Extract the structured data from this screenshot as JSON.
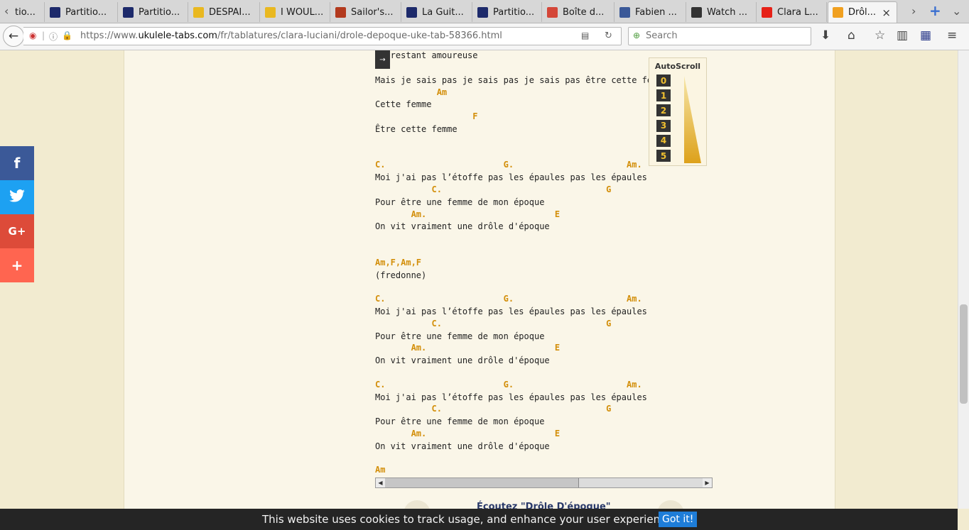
{
  "browser": {
    "tabs": [
      {
        "label": "tio...",
        "icon": "page",
        "color": ""
      },
      {
        "label": "Partitio...",
        "icon": "b-logo",
        "color": "#1d2a6b"
      },
      {
        "label": "Partitio...",
        "icon": "b-logo",
        "color": "#1d2a6b"
      },
      {
        "label": "DESPAI...",
        "icon": "shield-logo",
        "color": "#e9b820"
      },
      {
        "label": "I WOUL...",
        "icon": "shield-logo",
        "color": "#e9b820"
      },
      {
        "label": "Sailor's...",
        "icon": "sailor-logo",
        "color": "#b33a1e"
      },
      {
        "label": "La Guit...",
        "icon": "pick-logo",
        "color": "#1d2a6b"
      },
      {
        "label": "Partitio...",
        "icon": "b-logo",
        "color": "#1d2a6b"
      },
      {
        "label": "Boîte d...",
        "icon": "gmail-logo",
        "color": "#d44638"
      },
      {
        "label": "Fabien ...",
        "icon": "facebook-logo",
        "color": "#3b5998"
      },
      {
        "label": "Watch ...",
        "icon": "infinity-logo",
        "color": "#333333"
      },
      {
        "label": "Clara L...",
        "icon": "youtube-logo",
        "color": "#e62117"
      },
      {
        "label": "Drôl...",
        "icon": "ukulele-logo",
        "color": "#f0a020",
        "active": true
      }
    ],
    "url": {
      "prefix": "https://www.",
      "domain": "ukulele-tabs.com",
      "path": "/fr/tablatures/clara-luciani/drole-depoque-uke-tab-58366.html"
    },
    "search_placeholder": "Search"
  },
  "share": [
    {
      "label": "f",
      "icon": "facebook-icon",
      "color": "#3b5998"
    },
    {
      "label": "",
      "icon": "twitter-icon",
      "color": "#1da1f2"
    },
    {
      "label": "G+",
      "icon": "google-plus-icon",
      "color": "#dd4b39"
    },
    {
      "label": "+",
      "icon": "share-more-icon",
      "color": "#ff6550"
    }
  ],
  "autoscroll": {
    "title": "AutoScroll",
    "speeds": [
      "0",
      "1",
      "2",
      "3",
      "4",
      "5"
    ]
  },
  "tab_lines": [
    {
      "t": "lyric",
      "text": "   restant amoureuse"
    },
    {
      "t": "lyric",
      "text": "Mais je sais pas je sais pas je sais pas être cette femme"
    },
    {
      "t": "chord",
      "text": "            Am"
    },
    {
      "t": "lyric",
      "text": "Cette femme"
    },
    {
      "t": "chord",
      "text": "                   F"
    },
    {
      "t": "lyric",
      "text": "Être cette femme"
    },
    {
      "t": "chord",
      "text": "C.                       G.                      Am."
    },
    {
      "t": "lyric",
      "text": "Moi j'ai pas l’étoffe pas les épaules pas les épaules"
    },
    {
      "t": "chord",
      "text": "           C.                                G"
    },
    {
      "t": "lyric",
      "text": "Pour être une femme de mon époque"
    },
    {
      "t": "chord",
      "text": "       Am.                         E"
    },
    {
      "t": "lyric",
      "text": "On vit vraiment une drôle d'époque"
    },
    {
      "t": "chord",
      "text": "Am,F,Am,F"
    },
    {
      "t": "lyric",
      "text": "(fredonne)"
    },
    {
      "t": "chord",
      "text": "C.                       G.                      Am."
    },
    {
      "t": "lyric",
      "text": "Moi j'ai pas l’étoffe pas les épaules pas les épaules"
    },
    {
      "t": "chord",
      "text": "           C.                                G"
    },
    {
      "t": "lyric",
      "text": "Pour être une femme de mon époque"
    },
    {
      "t": "chord",
      "text": "       Am.                         E"
    },
    {
      "t": "lyric",
      "text": "On vit vraiment une drôle d'époque"
    },
    {
      "t": "chord",
      "text": "C.                       G.                      Am."
    },
    {
      "t": "lyric",
      "text": "Moi j'ai pas l’étoffe pas les épaules pas les épaules"
    },
    {
      "t": "chord",
      "text": "           C.                                G"
    },
    {
      "t": "lyric",
      "text": "Pour être une femme de mon époque"
    },
    {
      "t": "chord",
      "text": "       Am.                         E"
    },
    {
      "t": "lyric",
      "text": "On vit vraiment une drôle d'époque"
    },
    {
      "t": "chord",
      "text": "Am"
    }
  ],
  "listen_link": "Écoutez \"Drôle D'époque\"",
  "cookie": {
    "text": "This website uses cookies to track usage, and enhance your user experience.",
    "button": "Got it!"
  }
}
